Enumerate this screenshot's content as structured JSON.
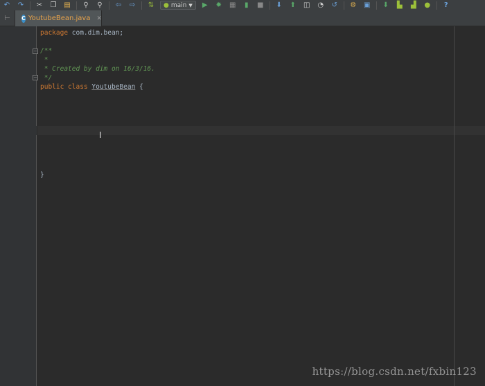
{
  "toolbar": {
    "run_config": "main",
    "icons": [
      "undo-icon",
      "redo-icon",
      "cut-icon",
      "copy-icon",
      "paste-icon",
      "find-icon",
      "replace-icon",
      "back-icon",
      "forward-icon",
      "make-icon",
      "run-icon",
      "debug-icon",
      "coverage-icon",
      "attach-icon",
      "stop-icon",
      "vcs-update-icon",
      "vcs-commit-icon",
      "vcs-compare-icon",
      "vcs-history-icon",
      "vcs-revert-icon",
      "settings-icon",
      "project-structure-icon",
      "sdk-manager-icon",
      "avd-manager-icon",
      "sync-icon",
      "android-monitor-icon",
      "help-icon"
    ],
    "help_label": "?"
  },
  "tabs": [
    {
      "label": "YoutubeBean.java",
      "icon": "class-c-icon",
      "icon_letter": "C",
      "active": true
    }
  ],
  "editor": {
    "lines": {
      "package_kw": "package",
      "package_name": " com.dim.bean;",
      "doc_open": "/**",
      "doc_star": " *",
      "doc_created": " * Created by dim on 16/3/16.",
      "doc_close": " */",
      "public_kw": "public",
      "class_kw": " class ",
      "class_name": "YoutubeBean",
      "brace_open": " {",
      "brace_close": "}"
    }
  },
  "watermark": "https://blog.csdn.net/fxbin123",
  "colors": {
    "background": "#2b2b2b",
    "keyword": "#cc7832",
    "comment": "#629755",
    "text": "#a9b7c6",
    "tab_label": "#e8a34b"
  }
}
